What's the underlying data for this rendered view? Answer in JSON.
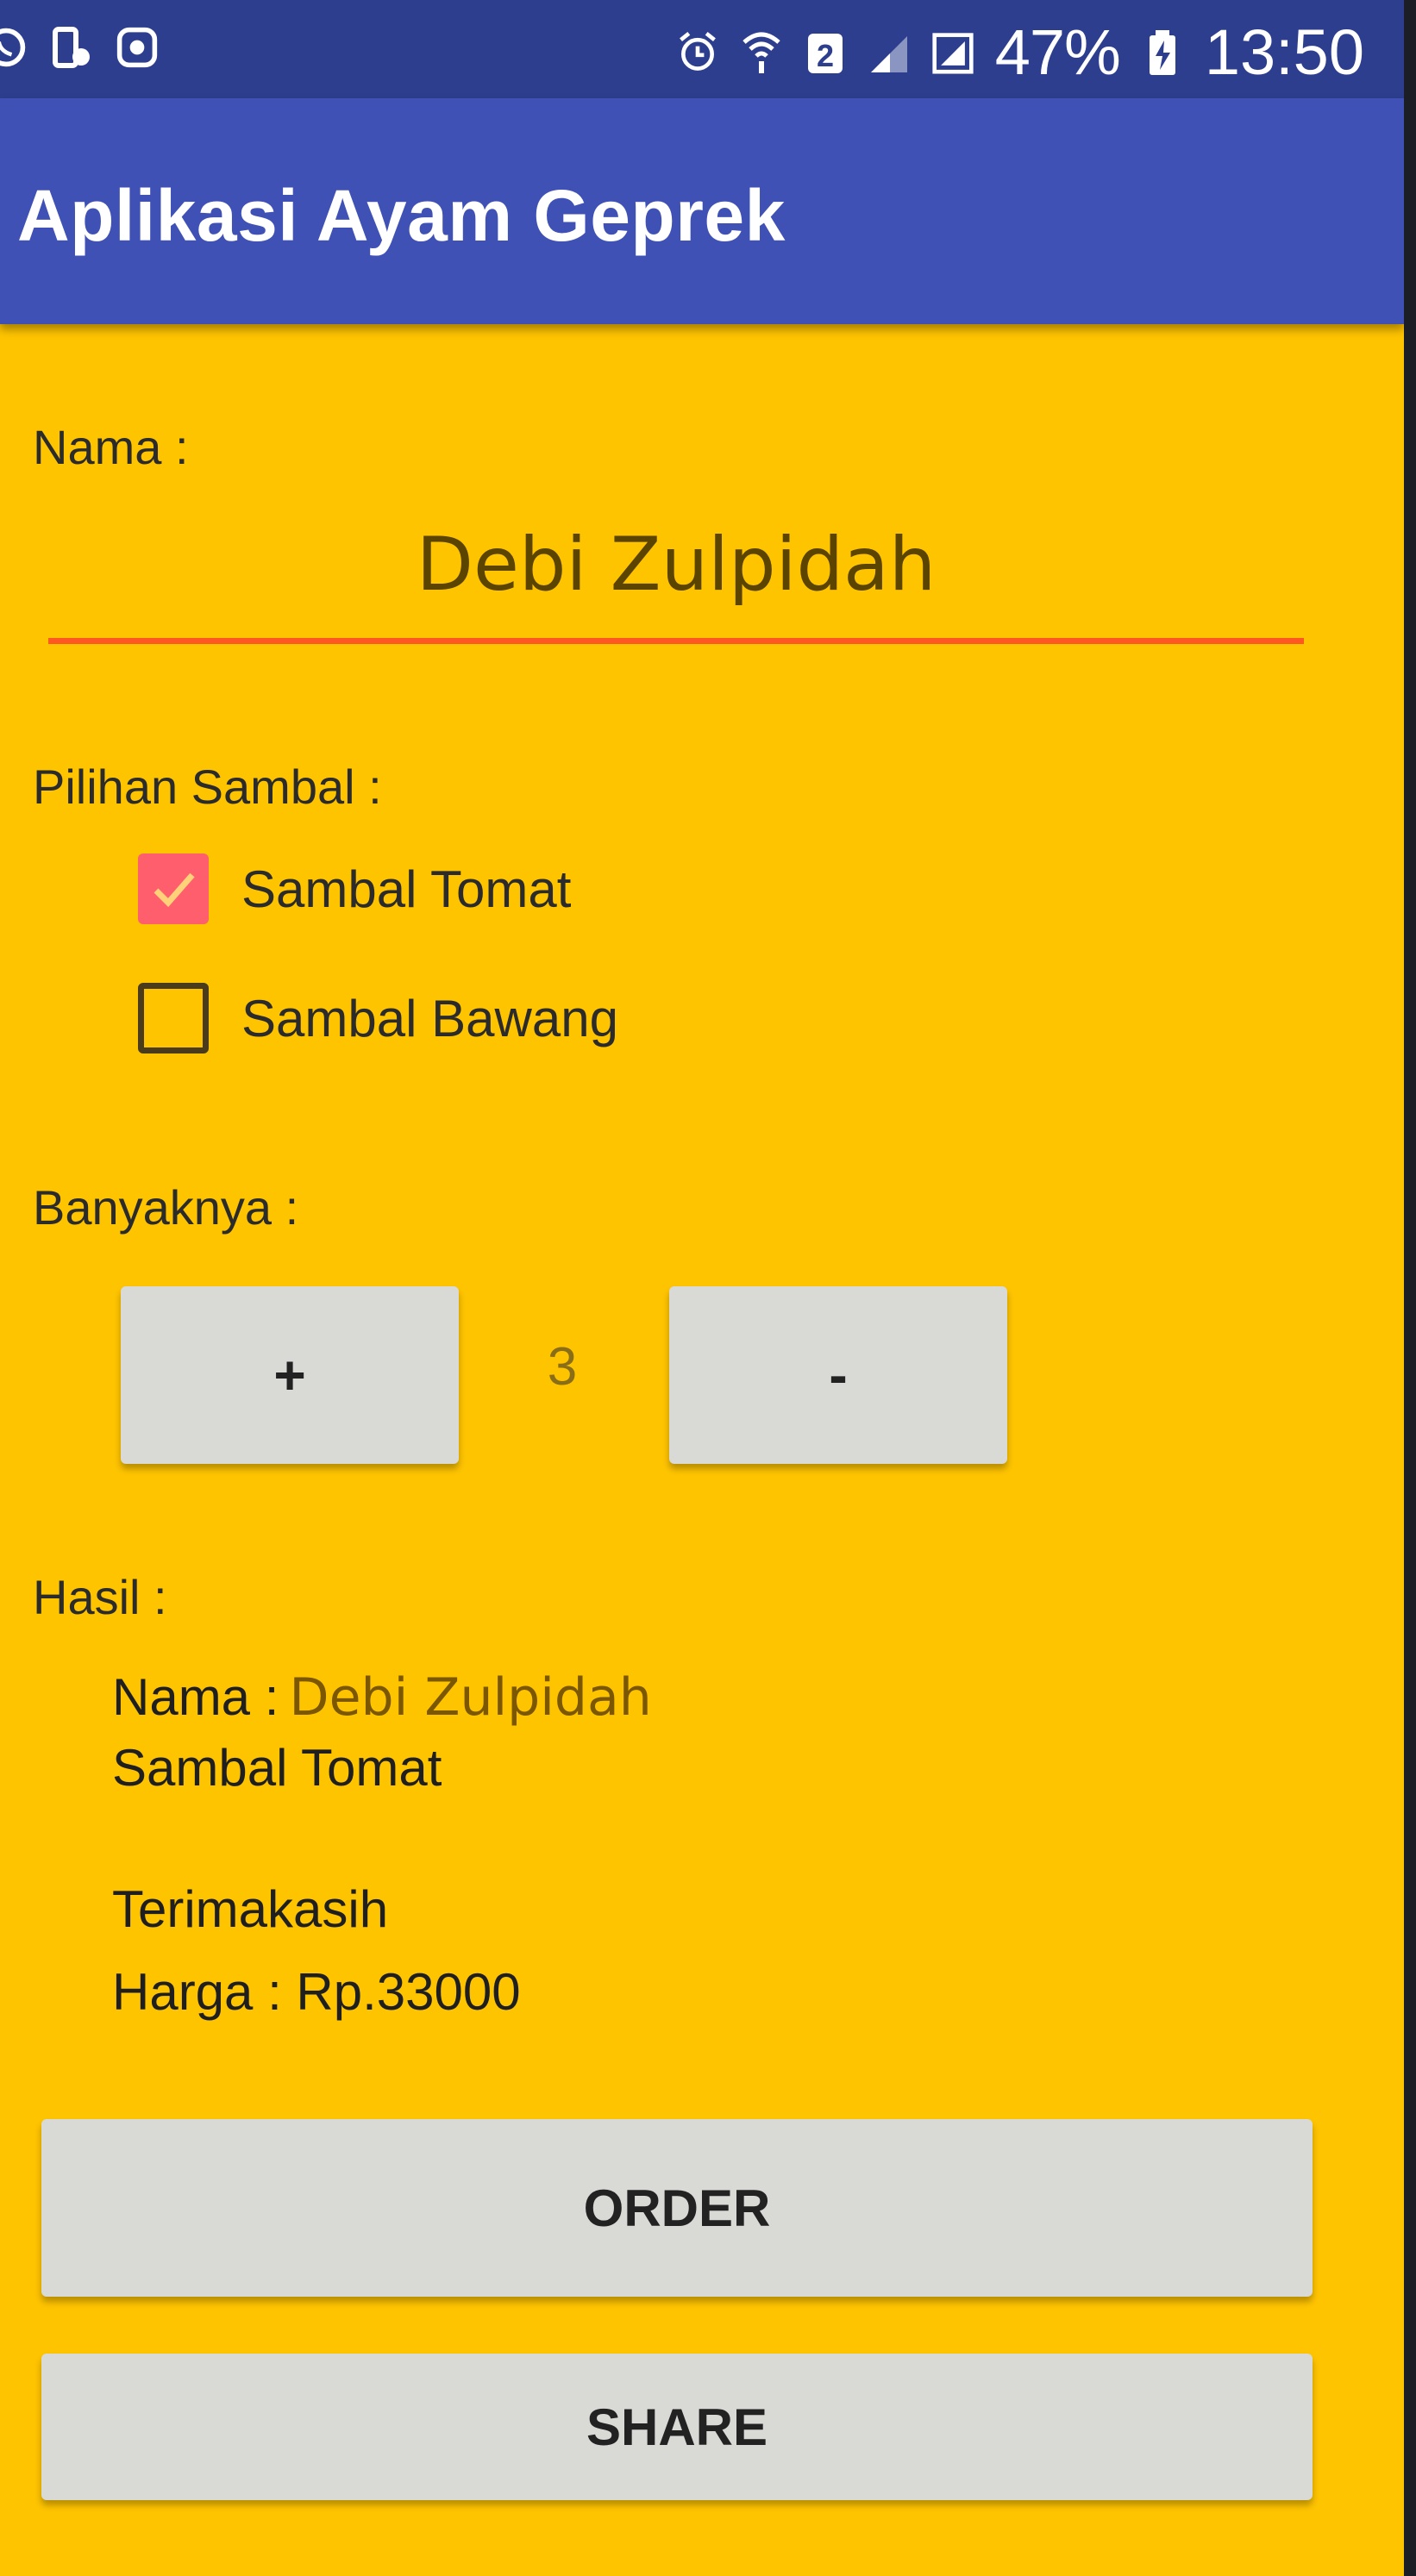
{
  "status_bar": {
    "battery_percent": "47%",
    "time": "13:50",
    "left_icons": [
      "whatsapp-icon",
      "phone-sync-icon",
      "record-icon"
    ],
    "right_icons": [
      "alarm-icon",
      "wifi-icon",
      "sim-2-icon",
      "signal-icon",
      "signal-icon",
      "battery-charging-icon"
    ]
  },
  "app_bar": {
    "title": "Aplikasi Ayam Geprek",
    "color": "#3f51b5"
  },
  "form": {
    "name_label": "Nama :",
    "name_value": "Debi Zulpidah",
    "sambal_label": "Pilihan Sambal :",
    "options": [
      {
        "label": "Sambal Tomat",
        "checked": true
      },
      {
        "label": "Sambal Bawang",
        "checked": false
      }
    ],
    "quantity_label": "Banyaknya :",
    "plus_label": "+",
    "minus_label": "-",
    "quantity_value": "3"
  },
  "result": {
    "label": "Hasil :",
    "name_prefix": "Nama :",
    "name_value": "Debi Zulpidah",
    "sambal": "Sambal Tomat",
    "thanks": "Terimakasih",
    "price": "Harga : Rp.33000"
  },
  "actions": {
    "order_label": "ORDER",
    "share_label": "SHARE"
  },
  "colors": {
    "background": "#ffc400",
    "accent": "#ff5722",
    "checkbox_checked": "#ff5f6d"
  }
}
